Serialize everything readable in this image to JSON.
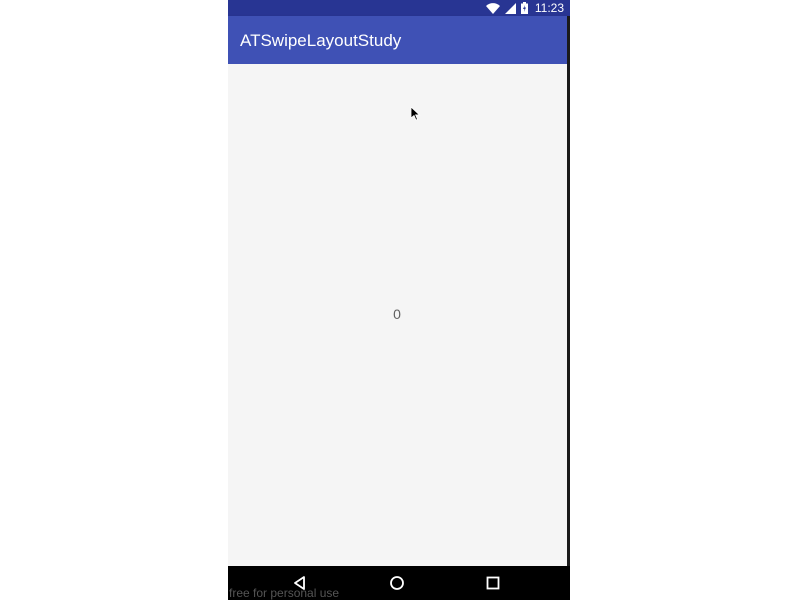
{
  "status_bar": {
    "time": "11:23",
    "icons": [
      "wifi-icon",
      "cell-signal-icon",
      "battery-charging-icon"
    ],
    "color": "#283593"
  },
  "app_bar": {
    "title": "ATSwipeLayoutStudy",
    "color": "#3f51b5"
  },
  "content": {
    "counter_value": "0"
  },
  "nav_bar": {
    "buttons": [
      "back-icon",
      "home-icon",
      "recents-icon"
    ]
  },
  "watermark": "free for personal use"
}
